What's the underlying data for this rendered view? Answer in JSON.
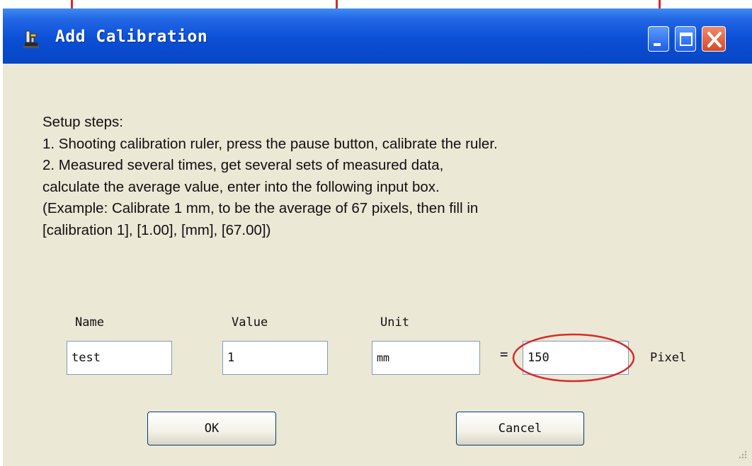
{
  "window": {
    "title": "Add Calibration",
    "icons": {
      "app": "app-icon",
      "minimize": "minimize-icon",
      "maximize": "maximize-icon",
      "close": "close-icon"
    }
  },
  "instructions": {
    "heading": "Setup steps:",
    "lines": [
      "1. Shooting calibration ruler, press the pause button, calibrate the ruler.",
      "2. Measured several times, get several sets of measured data,",
      "calculate the average value, enter into the following input box.",
      "(Example: Calibrate 1 mm, to be the average of 67 pixels, then fill in",
      "[calibration 1], [1.00], [mm], [67.00])"
    ]
  },
  "form": {
    "name_label": "Name",
    "value_label": "Value",
    "unit_label": "Unit",
    "name_value": "test",
    "value_value": "1",
    "unit_value": "mm",
    "equals": "=",
    "pixel_value": "150",
    "pixel_label": "Pixel"
  },
  "buttons": {
    "ok": "OK",
    "cancel": "Cancel"
  },
  "colors": {
    "titlebar": "#0a4fd6",
    "dialog_bg": "#ece8d6",
    "highlight": "#d52b2b"
  }
}
